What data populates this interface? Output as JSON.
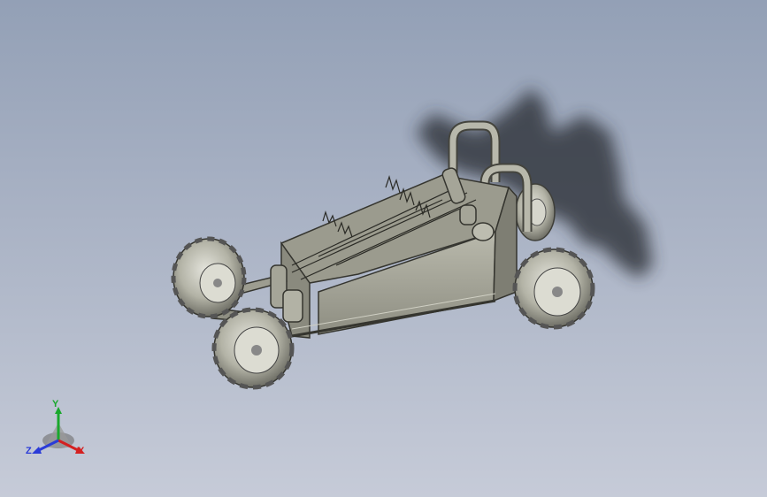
{
  "view": {
    "model_name": "go-kart-frame-assembly",
    "background_top": "#93a0b6",
    "background_bottom": "#c6cbd8",
    "part_color": "#a9a99b",
    "shadow_color": "#2b2f36"
  },
  "triad": {
    "x_label": "X",
    "y_label": "Y",
    "z_label": "Z",
    "x_color": "#d42020",
    "y_color": "#19a82c",
    "z_color": "#2a3bd8"
  }
}
